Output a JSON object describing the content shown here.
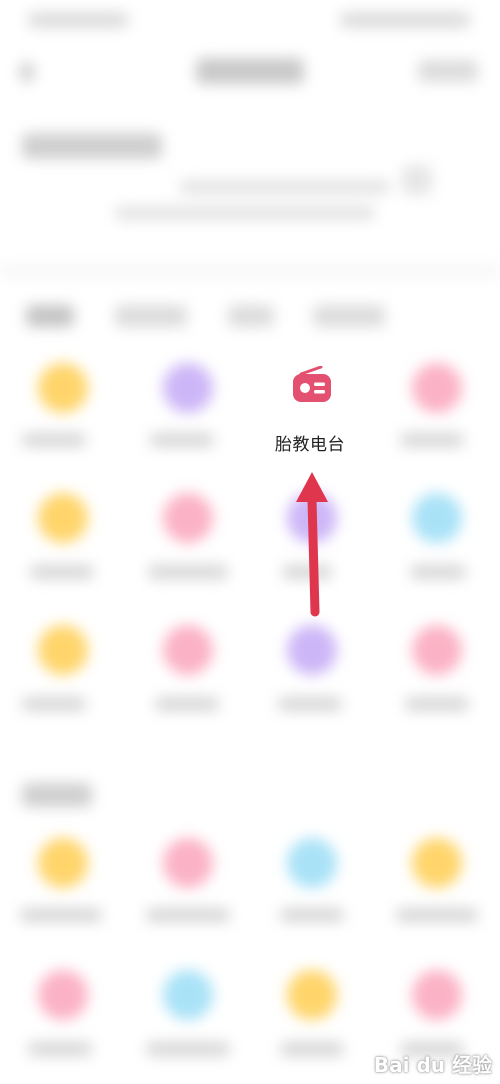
{
  "highlight": {
    "label": "胎教电台",
    "icon": "radio-icon"
  },
  "colors": {
    "accent": "#e4506f",
    "arrow": "#e0364d",
    "yellow": "#ffd56b",
    "purple": "#cdb6f7",
    "pink": "#fbb2c6",
    "blue": "#a9e2f7"
  },
  "watermark": {
    "text": "Bai du 经验"
  }
}
